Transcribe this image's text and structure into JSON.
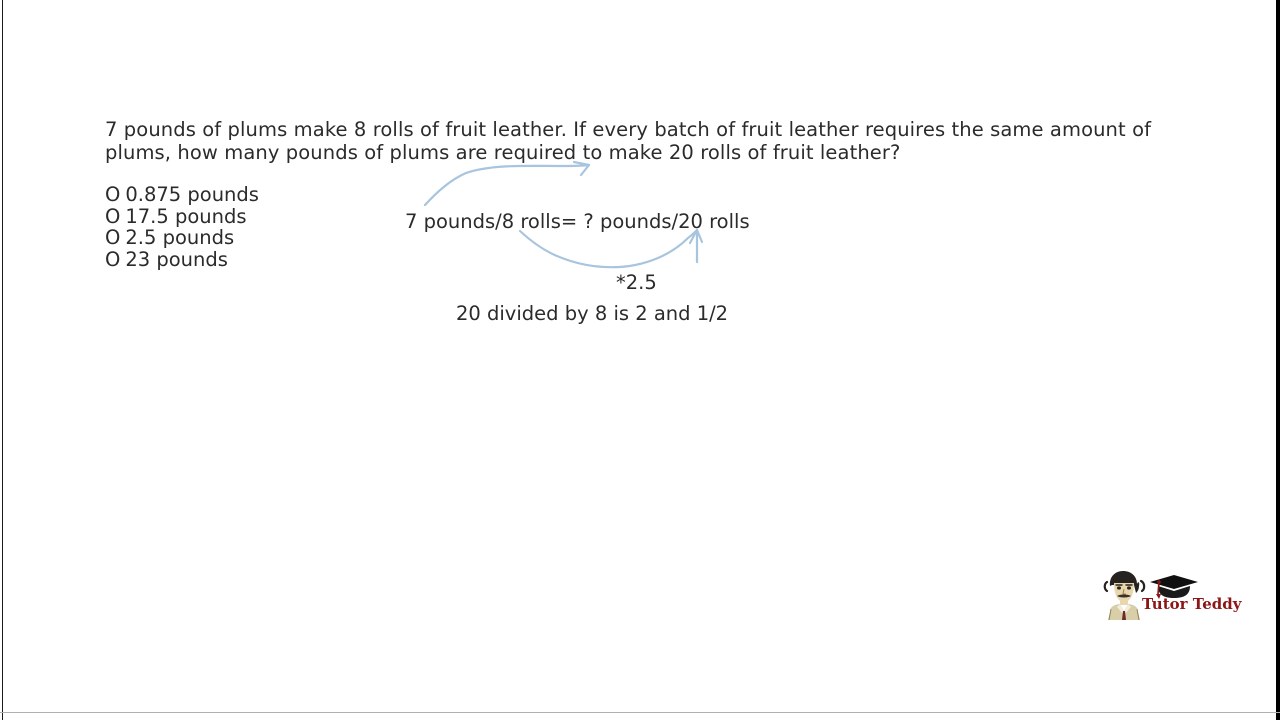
{
  "page": {
    "background_color": "#ffffff",
    "text_color": "#2b2b2b",
    "ink_color": "#a8c4de"
  },
  "question": {
    "text": "7 pounds of plums make 8 rolls of fruit leather. If every batch of fruit leather requires the same amount of plums, how many pounds of plums are required to make 20 rolls of fruit leather?"
  },
  "choices": [
    {
      "bullet": "O",
      "label": "0.875 pounds"
    },
    {
      "bullet": "O",
      "label": "17.5 pounds"
    },
    {
      "bullet": "O",
      "label": "2.5 pounds"
    },
    {
      "bullet": "O",
      "label": "23 pounds"
    }
  ],
  "work": {
    "equation": "7 pounds/8 rolls= ? pounds/20 rolls",
    "multiplier": "*2.5",
    "note": "20 divided by 8 is 2 and 1/2"
  },
  "annotations": {
    "upper_arrow_name": "arrow-to-20-rolls",
    "lower_arrow_name": "arrow-8-to-20-rolls"
  },
  "logo": {
    "text": "Tutor Teddy",
    "text_color": "#8c1616",
    "cap_color": "#101010",
    "tassel_color": "#8c1616"
  }
}
